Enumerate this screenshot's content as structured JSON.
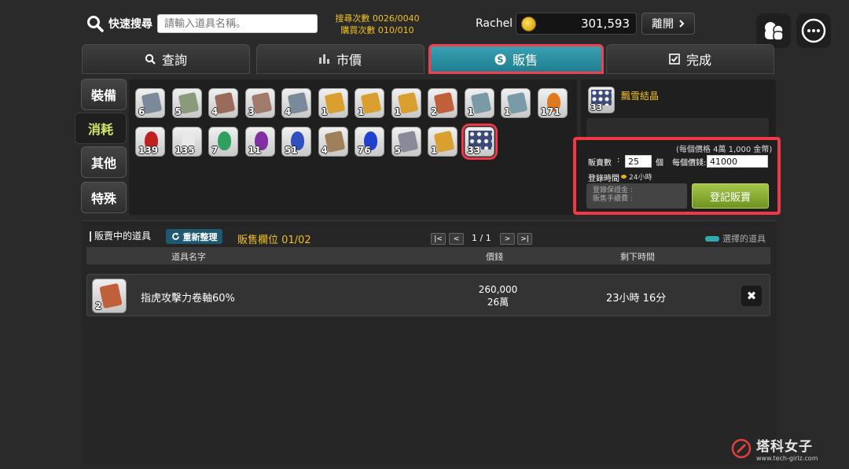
{
  "header": {
    "search_label": "快速搜尋",
    "search_placeholder": "請輸入道具名稱。",
    "search_count": "搜尋次數 0026/0040",
    "buy_count": "購買次數 010/010",
    "user_name": "Rachel",
    "money": "301,593",
    "leave_label": "離開"
  },
  "tabs": [
    {
      "label": "查詢",
      "icon": "search-icon"
    },
    {
      "label": "市價",
      "icon": "bar-chart-icon"
    },
    {
      "label": "販售",
      "icon": "sell-icon",
      "active": true
    },
    {
      "label": "完成",
      "icon": "checkbox-icon"
    }
  ],
  "categories": [
    {
      "label": "裝備"
    },
    {
      "label": "消耗",
      "active": true
    },
    {
      "label": "其他"
    },
    {
      "label": "特殊"
    }
  ],
  "inventory": [
    {
      "kind": "scroll",
      "color": "#7a8a99",
      "qty": "6"
    },
    {
      "kind": "scroll",
      "color": "#8a9a7a",
      "qty": "5"
    },
    {
      "kind": "scroll",
      "color": "#9a6a5a",
      "qty": "4"
    },
    {
      "kind": "scroll",
      "color": "#a07a6a",
      "qty": "3"
    },
    {
      "kind": "scroll",
      "color": "#7a8a9a",
      "qty": "4"
    },
    {
      "kind": "scroll",
      "color": "#d9a030",
      "qty": "1"
    },
    {
      "kind": "scroll",
      "color": "#d9a030",
      "qty": "1"
    },
    {
      "kind": "scroll",
      "color": "#d9a030",
      "qty": "1"
    },
    {
      "kind": "scroll",
      "color": "#c0603a",
      "qty": "2"
    },
    {
      "kind": "scroll",
      "color": "#7a9aa8",
      "qty": "1"
    },
    {
      "kind": "scroll",
      "color": "#7a9aa8",
      "qty": "1"
    },
    {
      "kind": "potion",
      "color": "#e07a20",
      "qty": "171"
    },
    {
      "kind": "potion",
      "color": "#c02020",
      "qty": "139"
    },
    {
      "kind": "potion",
      "color": "#e8e8e8",
      "qty": "135"
    },
    {
      "kind": "potion",
      "color": "#30a060",
      "qty": "7"
    },
    {
      "kind": "potion",
      "color": "#8030a0",
      "qty": "11"
    },
    {
      "kind": "potion",
      "color": "#3050c0",
      "qty": "51"
    },
    {
      "kind": "scroll",
      "color": "#a0805a",
      "qty": "4"
    },
    {
      "kind": "potion",
      "color": "#2040d0",
      "qty": "76"
    },
    {
      "kind": "scroll",
      "color": "#8a8a9a",
      "qty": "5"
    },
    {
      "kind": "scroll",
      "color": "#d9a030",
      "qty": "1"
    },
    {
      "kind": "crystal",
      "color": "#3b4a7a",
      "qty": "33",
      "selected": true
    }
  ],
  "sale": {
    "item_name": "飄雪結晶",
    "item_qty": "33",
    "unit_price_note": "(每個價格 4萬 1,000 金幣)",
    "qty_label": "販賣數",
    "colon": ":",
    "qty_value": "25",
    "qty_unit": "個",
    "price_label": "每個價錢:",
    "price_value": "41000",
    "register_time_label": "登錄時間",
    "register_time_value": "24小時",
    "deposit_line1": "登錄保證金 :",
    "deposit_line2": "販售手續費 :",
    "register_button": "登記販賣"
  },
  "list": {
    "title": "販賣中的道具",
    "refresh_label": "重新整理",
    "slot_count": "販售欄位 01/02",
    "page": "1 / 1",
    "legend": "選擇的道具",
    "columns": {
      "name": "道具名字",
      "price": "價錢",
      "remaining": "剩下時間"
    },
    "rows": [
      {
        "name": "指虎攻擊力卷軸60%",
        "qty": "2",
        "price": "260,000",
        "price_short": "26萬",
        "remaining": "23小時 16分"
      }
    ]
  },
  "watermark": {
    "main": "塔科女子",
    "sub": "www.tech-girlz.com"
  }
}
